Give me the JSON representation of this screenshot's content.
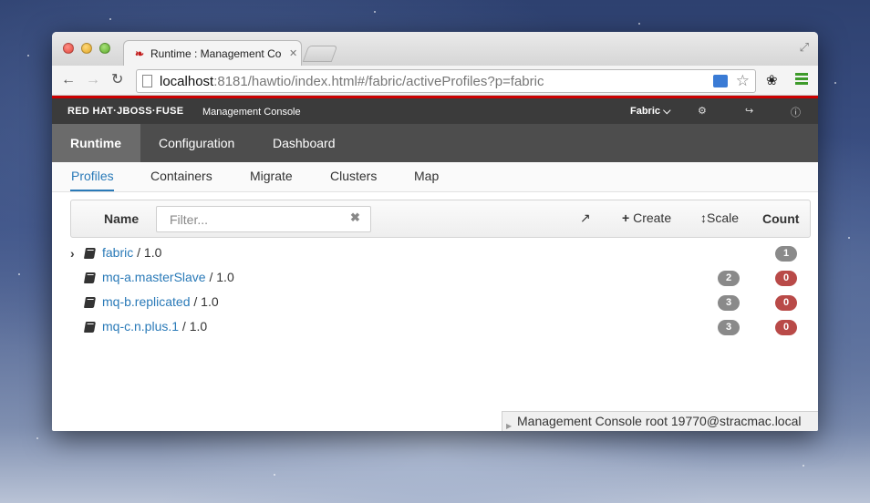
{
  "browser": {
    "tab_title": "Runtime : Management Co",
    "url_host": "localhost",
    "url_rest": ":8181/hawtio/index.html#/fabric/activeProfiles?p=fabric"
  },
  "header": {
    "brand": "RED HAT·JBOSS·FUSE",
    "subtitle": "Management Console",
    "fabric_menu": "Fabric"
  },
  "mainnav": [
    "Runtime",
    "Configuration",
    "Dashboard"
  ],
  "subnav": [
    "Profiles",
    "Containers",
    "Migrate",
    "Clusters",
    "Map"
  ],
  "grid": {
    "name_header": "Name",
    "filter_placeholder": "Filter...",
    "create_label": "Create",
    "scale_label": "Scale",
    "count_header": "Count"
  },
  "profiles": [
    {
      "name": "fabric",
      "version": " / 1.0",
      "containers": "1",
      "problems": ""
    },
    {
      "name": "mq-a.masterSlave",
      "version": " / 1.0",
      "containers": "2",
      "problems": "0"
    },
    {
      "name": "mq-b.replicated",
      "version": " / 1.0",
      "containers": "3",
      "problems": "0"
    },
    {
      "name": "mq-c.n.plus.1",
      "version": " / 1.0",
      "containers": "3",
      "problems": "0"
    }
  ],
  "status": {
    "text": "Management Console  root  19770@stracmac.local"
  },
  "colors": {
    "accent_red": "#cc0000",
    "link_blue": "#2a7ab8",
    "badge_grey": "#8a8a8a",
    "badge_red": "#b94a48"
  }
}
